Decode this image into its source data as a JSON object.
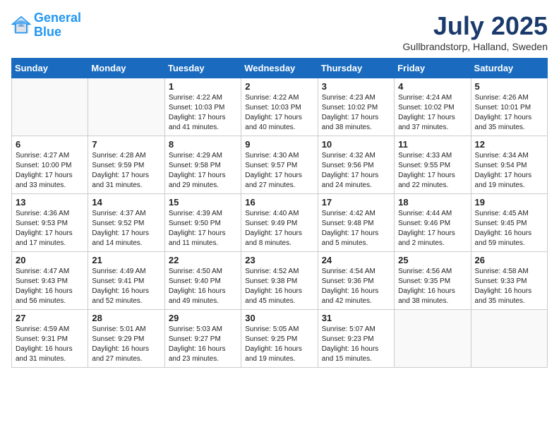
{
  "logo": {
    "line1": "General",
    "line2": "Blue"
  },
  "title": "July 2025",
  "location": "Gullbrandstorp, Halland, Sweden",
  "days_of_week": [
    "Sunday",
    "Monday",
    "Tuesday",
    "Wednesday",
    "Thursday",
    "Friday",
    "Saturday"
  ],
  "weeks": [
    [
      {
        "day": "",
        "info": ""
      },
      {
        "day": "",
        "info": ""
      },
      {
        "day": "1",
        "sunrise": "4:22 AM",
        "sunset": "10:03 PM",
        "daylight": "17 hours and 41 minutes."
      },
      {
        "day": "2",
        "sunrise": "4:22 AM",
        "sunset": "10:03 PM",
        "daylight": "17 hours and 40 minutes."
      },
      {
        "day": "3",
        "sunrise": "4:23 AM",
        "sunset": "10:02 PM",
        "daylight": "17 hours and 38 minutes."
      },
      {
        "day": "4",
        "sunrise": "4:24 AM",
        "sunset": "10:02 PM",
        "daylight": "17 hours and 37 minutes."
      },
      {
        "day": "5",
        "sunrise": "4:26 AM",
        "sunset": "10:01 PM",
        "daylight": "17 hours and 35 minutes."
      }
    ],
    [
      {
        "day": "6",
        "sunrise": "4:27 AM",
        "sunset": "10:00 PM",
        "daylight": "17 hours and 33 minutes."
      },
      {
        "day": "7",
        "sunrise": "4:28 AM",
        "sunset": "9:59 PM",
        "daylight": "17 hours and 31 minutes."
      },
      {
        "day": "8",
        "sunrise": "4:29 AM",
        "sunset": "9:58 PM",
        "daylight": "17 hours and 29 minutes."
      },
      {
        "day": "9",
        "sunrise": "4:30 AM",
        "sunset": "9:57 PM",
        "daylight": "17 hours and 27 minutes."
      },
      {
        "day": "10",
        "sunrise": "4:32 AM",
        "sunset": "9:56 PM",
        "daylight": "17 hours and 24 minutes."
      },
      {
        "day": "11",
        "sunrise": "4:33 AM",
        "sunset": "9:55 PM",
        "daylight": "17 hours and 22 minutes."
      },
      {
        "day": "12",
        "sunrise": "4:34 AM",
        "sunset": "9:54 PM",
        "daylight": "17 hours and 19 minutes."
      }
    ],
    [
      {
        "day": "13",
        "sunrise": "4:36 AM",
        "sunset": "9:53 PM",
        "daylight": "17 hours and 17 minutes."
      },
      {
        "day": "14",
        "sunrise": "4:37 AM",
        "sunset": "9:52 PM",
        "daylight": "17 hours and 14 minutes."
      },
      {
        "day": "15",
        "sunrise": "4:39 AM",
        "sunset": "9:50 PM",
        "daylight": "17 hours and 11 minutes."
      },
      {
        "day": "16",
        "sunrise": "4:40 AM",
        "sunset": "9:49 PM",
        "daylight": "17 hours and 8 minutes."
      },
      {
        "day": "17",
        "sunrise": "4:42 AM",
        "sunset": "9:48 PM",
        "daylight": "17 hours and 5 minutes."
      },
      {
        "day": "18",
        "sunrise": "4:44 AM",
        "sunset": "9:46 PM",
        "daylight": "17 hours and 2 minutes."
      },
      {
        "day": "19",
        "sunrise": "4:45 AM",
        "sunset": "9:45 PM",
        "daylight": "16 hours and 59 minutes."
      }
    ],
    [
      {
        "day": "20",
        "sunrise": "4:47 AM",
        "sunset": "9:43 PM",
        "daylight": "16 hours and 56 minutes."
      },
      {
        "day": "21",
        "sunrise": "4:49 AM",
        "sunset": "9:41 PM",
        "daylight": "16 hours and 52 minutes."
      },
      {
        "day": "22",
        "sunrise": "4:50 AM",
        "sunset": "9:40 PM",
        "daylight": "16 hours and 49 minutes."
      },
      {
        "day": "23",
        "sunrise": "4:52 AM",
        "sunset": "9:38 PM",
        "daylight": "16 hours and 45 minutes."
      },
      {
        "day": "24",
        "sunrise": "4:54 AM",
        "sunset": "9:36 PM",
        "daylight": "16 hours and 42 minutes."
      },
      {
        "day": "25",
        "sunrise": "4:56 AM",
        "sunset": "9:35 PM",
        "daylight": "16 hours and 38 minutes."
      },
      {
        "day": "26",
        "sunrise": "4:58 AM",
        "sunset": "9:33 PM",
        "daylight": "16 hours and 35 minutes."
      }
    ],
    [
      {
        "day": "27",
        "sunrise": "4:59 AM",
        "sunset": "9:31 PM",
        "daylight": "16 hours and 31 minutes."
      },
      {
        "day": "28",
        "sunrise": "5:01 AM",
        "sunset": "9:29 PM",
        "daylight": "16 hours and 27 minutes."
      },
      {
        "day": "29",
        "sunrise": "5:03 AM",
        "sunset": "9:27 PM",
        "daylight": "16 hours and 23 minutes."
      },
      {
        "day": "30",
        "sunrise": "5:05 AM",
        "sunset": "9:25 PM",
        "daylight": "16 hours and 19 minutes."
      },
      {
        "day": "31",
        "sunrise": "5:07 AM",
        "sunset": "9:23 PM",
        "daylight": "16 hours and 15 minutes."
      },
      {
        "day": "",
        "info": ""
      },
      {
        "day": "",
        "info": ""
      }
    ]
  ]
}
